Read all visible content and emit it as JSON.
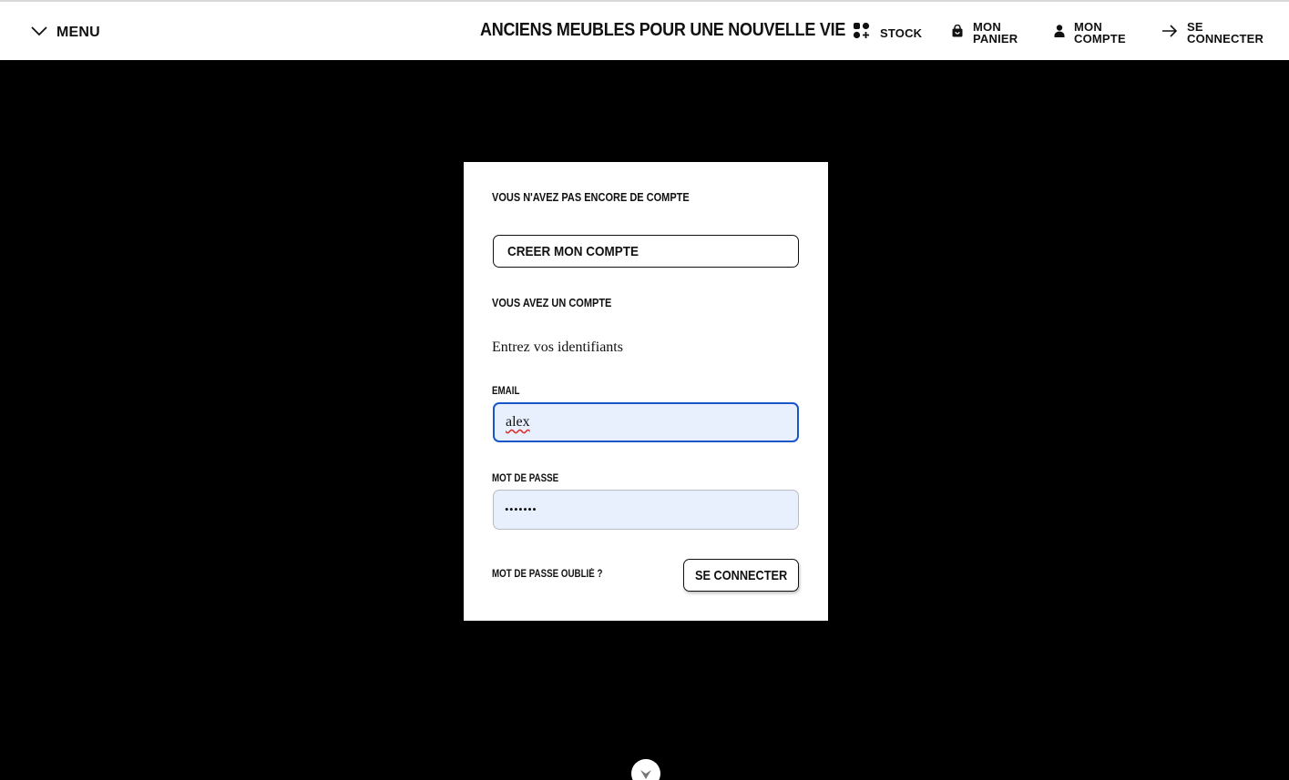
{
  "header": {
    "menu_label": "MENU",
    "site_title": "ANCIENS MEUBLES POUR UNE NOUVELLE VIE",
    "nav": {
      "stock": "STOCK",
      "panier_line1": "MON",
      "panier_line2": "PANIER",
      "compte_line1": "MON",
      "compte_line2": "COMPTE",
      "login_line1": "SE",
      "login_line2": "CONNECTER"
    }
  },
  "login_card": {
    "no_account_heading": "VOUS N'AVEZ PAS ENCORE DE COMPTE",
    "create_account_button": "CREER MON COMPTE",
    "has_account_heading": "VOUS AVEZ UN COMPTE",
    "intro": "Entrez vos identifiants",
    "email_label": "EMAIL",
    "email_value": "alex",
    "password_label": "MOT DE PASSE",
    "password_mask": "•••••••",
    "forgot_password": "MOT DE PASSE OUBLIé ?",
    "submit_button": "SE CONNECTER"
  },
  "icons": {
    "menu": "chevron-down-icon",
    "stock": "grid-plus-icon",
    "panier": "shopping-bag-icon",
    "compte": "user-icon",
    "login": "arrow-right-icon",
    "scroll": "chevron-down-circle-icon"
  },
  "colors": {
    "background": "#000000",
    "header_bg": "#ffffff",
    "input_bg": "#e8f0fe",
    "focus_border": "#1a56c8"
  }
}
